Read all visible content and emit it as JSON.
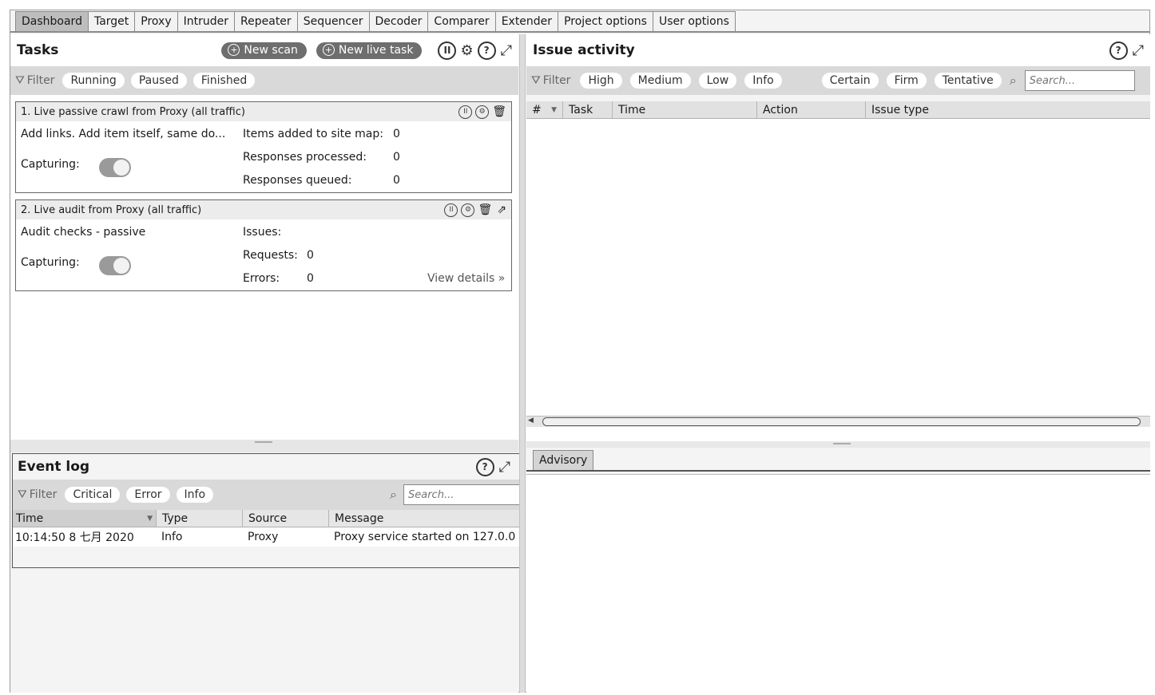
{
  "tabs": [
    "Dashboard",
    "Target",
    "Proxy",
    "Intruder",
    "Repeater",
    "Sequencer",
    "Decoder",
    "Comparer",
    "Extender",
    "Project options",
    "User options"
  ],
  "tasks": {
    "title": "Tasks",
    "new_scan": "New scan",
    "new_live_task": "New live task",
    "filter_label": "Filter",
    "filters": [
      "Running",
      "Paused",
      "Finished"
    ],
    "cards": [
      {
        "title": "1. Live passive crawl from Proxy (all traffic)",
        "description": "Add links. Add item itself, same do...",
        "capturing_label": "Capturing:",
        "stats": [
          {
            "label": "Items added to site map:",
            "value": "0"
          },
          {
            "label": "Responses processed:",
            "value": "0"
          },
          {
            "label": "Responses queued:",
            "value": "0"
          }
        ]
      },
      {
        "title": "2. Live audit from Proxy (all traffic)",
        "description": "Audit checks - passive",
        "capturing_label": "Capturing:",
        "stats": [
          {
            "label": "Issues:",
            "value": ""
          },
          {
            "label": "Requests:",
            "value": "0"
          },
          {
            "label": "Errors:",
            "value": "0"
          }
        ],
        "view_details": "View details"
      }
    ]
  },
  "issue_activity": {
    "title": "Issue activity",
    "filter_label": "Filter",
    "severity_filters": [
      "High",
      "Medium",
      "Low",
      "Info"
    ],
    "confidence_filters": [
      "Certain",
      "Firm",
      "Tentative"
    ],
    "search_placeholder": "Search...",
    "columns": [
      "#",
      "Task",
      "Time",
      "Action",
      "Issue type"
    ]
  },
  "advisory": {
    "tab": "Advisory"
  },
  "event_log": {
    "title": "Event log",
    "filter_label": "Filter",
    "filters": [
      "Critical",
      "Error",
      "Info"
    ],
    "search_placeholder": "Search...",
    "columns": [
      "Time",
      "Type",
      "Source",
      "Message"
    ],
    "rows": [
      {
        "time": "10:14:50 8 七月 2020",
        "type": "Info",
        "source": "Proxy",
        "message": "Proxy service started on 127.0.0"
      }
    ]
  }
}
